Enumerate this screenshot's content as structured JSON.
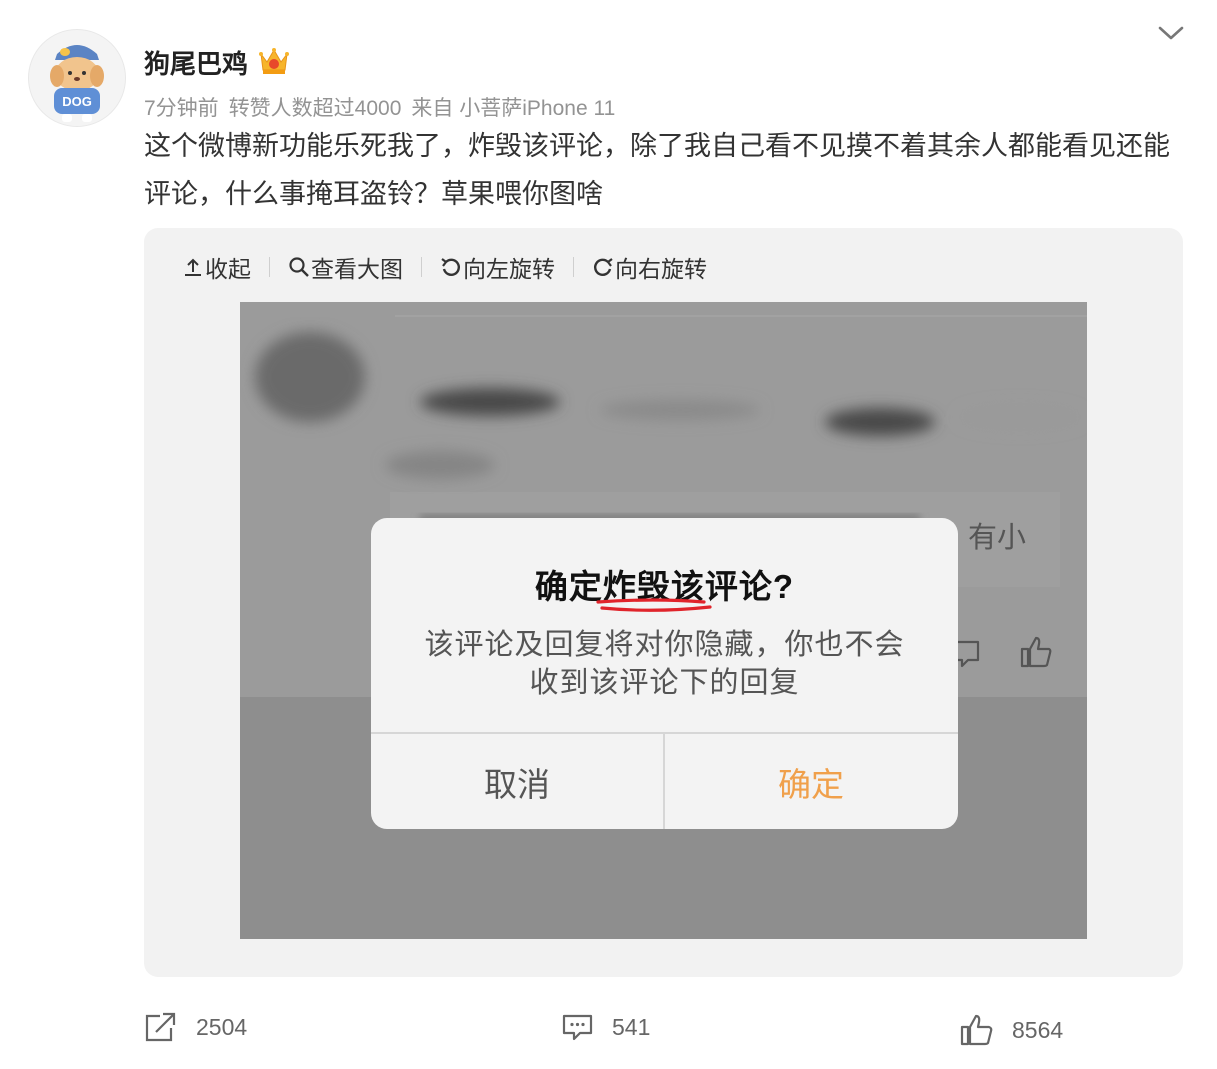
{
  "post": {
    "username": "狗尾巴鸡",
    "avatar_text": "DOG",
    "meta_time": "7分钟前",
    "meta_reposts": "转赞人数超过4000",
    "meta_source_prefix": "来自",
    "meta_source": "小菩萨iPhone 11",
    "text": "这个微博新功能乐死我了，炸毁该评论，除了我自己看不见摸不着其余人都能看见还能评论，什么事掩耳盗铃？草果喂你图啥"
  },
  "media_toolbar": {
    "collapse": "收起",
    "view_large": "查看大图",
    "rotate_left": "向左旋转",
    "rotate_right": "向右旋转"
  },
  "screenshot": {
    "background_fragment": "有小",
    "dialog": {
      "title": "确定炸毁该评论?",
      "message_line1": "该评论及回复将对你隐藏，你也不会",
      "message_line2": "收到该评论下的回复",
      "cancel": "取消",
      "confirm": "确定"
    }
  },
  "actions": {
    "repost_count": "2504",
    "comment_count": "541",
    "like_count": "8564"
  },
  "colors": {
    "accent_orange": "#f0a04b",
    "underline_red": "#e0242b",
    "meta_gray": "#939393"
  }
}
